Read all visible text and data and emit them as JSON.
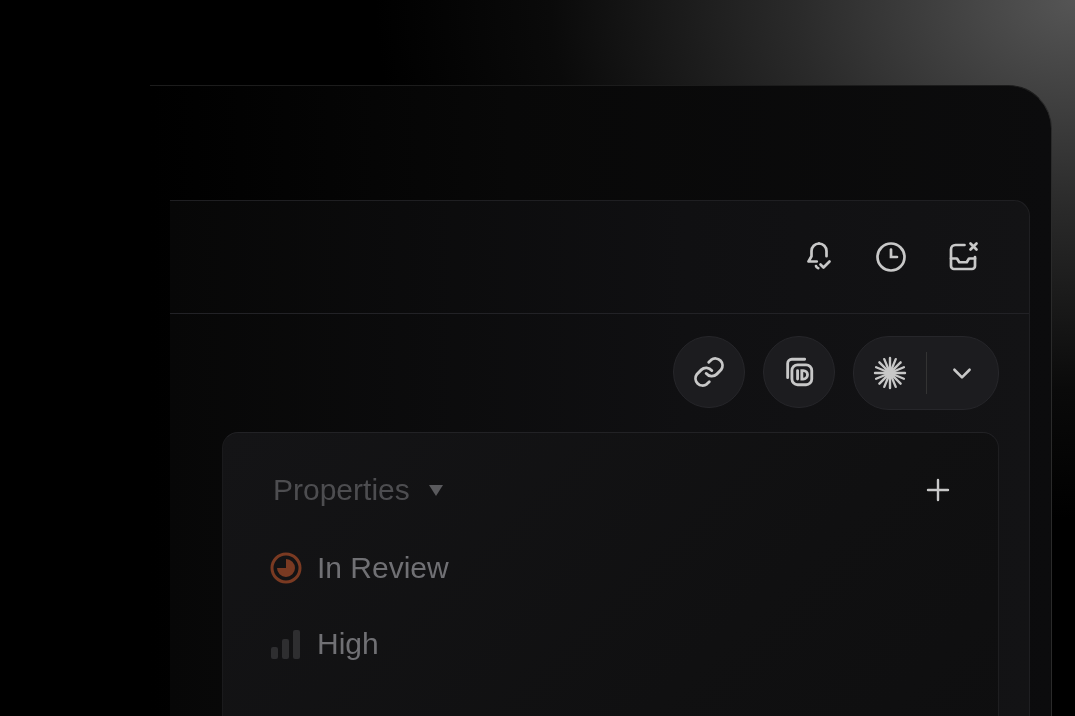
{
  "properties": {
    "title": "Properties",
    "expanded": true,
    "items": [
      {
        "kind": "status",
        "label": "In Review"
      },
      {
        "kind": "priority",
        "label": "High"
      }
    ]
  }
}
